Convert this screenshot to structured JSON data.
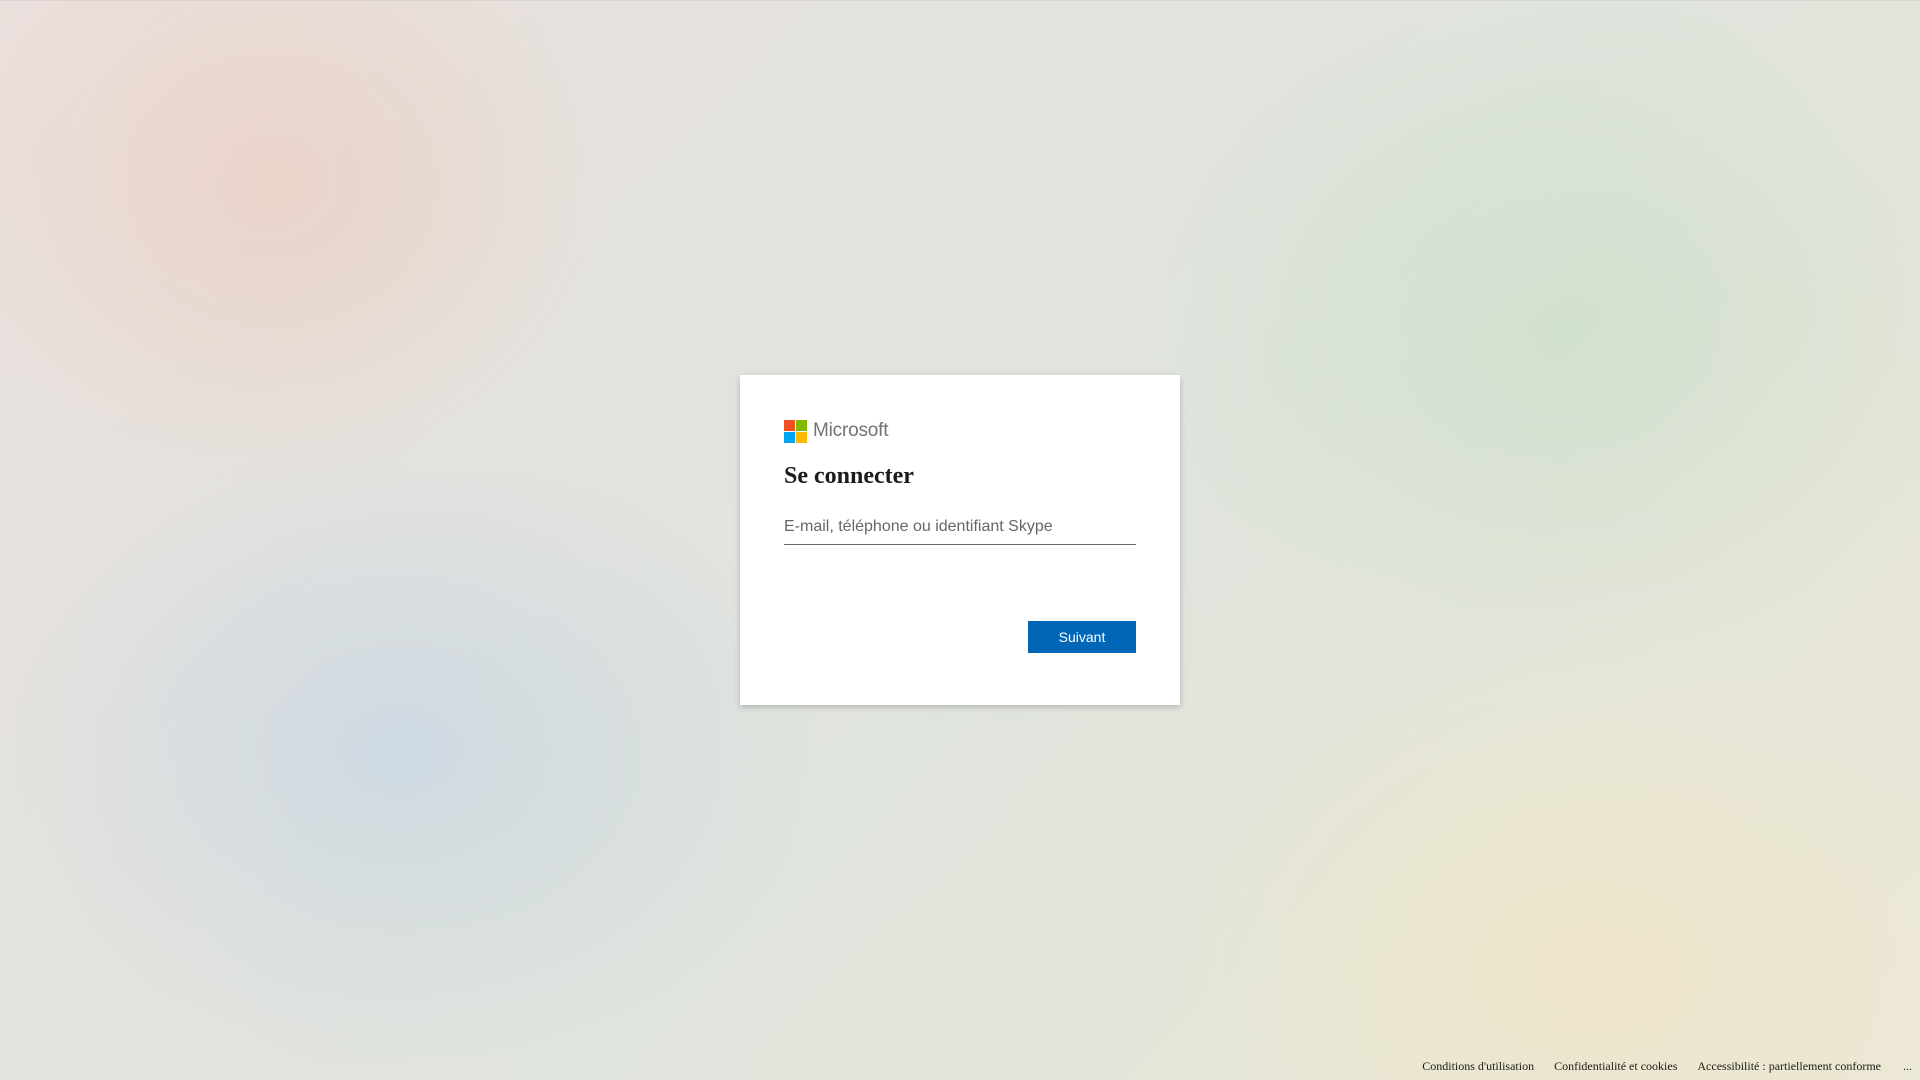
{
  "brand": {
    "logo_icon": "microsoft-logo-icon",
    "name": "Microsoft",
    "colors": {
      "red": "#f25022",
      "green": "#7fba00",
      "blue": "#00a4ef",
      "yellow": "#ffb900"
    }
  },
  "signin": {
    "title": "Se connecter",
    "email_placeholder": "E-mail, téléphone ou identifiant Skype",
    "email_value": "",
    "next_label": "Suivant",
    "accent_color": "#0067b8"
  },
  "footer": {
    "terms": "Conditions d'utilisation",
    "privacy": "Confidentialité et cookies",
    "accessibility": "Accessibilité : partiellement conforme",
    "more": "..."
  }
}
